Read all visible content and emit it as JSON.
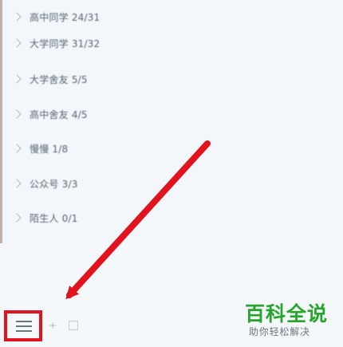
{
  "groups": [
    {
      "label": "高中同学 24/31"
    },
    {
      "label": "大学同学 31/32"
    },
    {
      "label": "大学舍友 5/5"
    },
    {
      "label": "高中舍友 4/5"
    },
    {
      "label": "慢慢 1/8"
    },
    {
      "label": "公众号 3/3"
    },
    {
      "label": "陌生人 0/1"
    }
  ],
  "bottom": {
    "menu_icon": "hamburger-menu-icon",
    "icon_2": "plus-icon",
    "icon_3": "grid-icon"
  },
  "watermark": {
    "title": "百科全说",
    "subtitle": "助你轻松解决"
  },
  "colors": {
    "arrow": "#e1141d",
    "highlight": "#e1141d",
    "watermark_green": "#27a52b"
  }
}
